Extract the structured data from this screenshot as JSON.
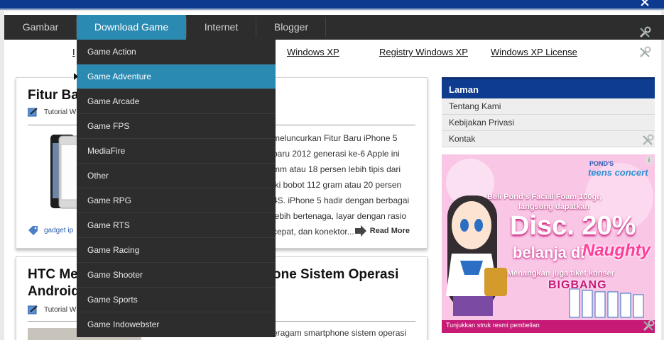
{
  "nav": {
    "items": [
      "Gambar",
      "Download Game",
      "Internet",
      "Blogger"
    ],
    "active": "Download Game"
  },
  "subnav": {
    "partial": "I",
    "links": [
      "Windows XP",
      "Registry Windows XP",
      "Windows XP License"
    ]
  },
  "dropdown": {
    "items": [
      "Game Action",
      "Game Adventure",
      "Game Arcade",
      "Game FPS",
      "MediaFire",
      "Other",
      "Game RPG",
      "Game RTS",
      "Game Racing",
      "Game Shooter",
      "Game Sports",
      "Game Indowebster"
    ],
    "hovered": "Game Adventure"
  },
  "post1": {
    "title_start": "Fitur Ba",
    "meta": "Tutorial W",
    "text_lines": [
      "meluncurkan Fitur Baru iPhone 5",
      "baru 2012 generasi ke-6 Apple ini",
      "mm atau 18 persen lebih tipis dari",
      "iki bobot 112 gram atau 20 persen",
      "4S. iPhone 5 hadir dengan berbagai",
      "lebih bertenaga, layar dengan rasio",
      "cepat, dan konektor..."
    ],
    "tag": "gadget ip",
    "read_more": "Read More"
  },
  "post2": {
    "title_line1_start": "HTC Me",
    "title_line1_end": "one Sistem Operasi",
    "title_line2": "Android",
    "meta": "Tutorial W",
    "text_line": "eragam smartphone sistem operasi"
  },
  "sidebar": {
    "heading": "Laman",
    "links": [
      "Tentang Kami",
      "Kebijakan Privasi",
      "Kontak"
    ]
  },
  "ad": {
    "brand_top": "POND'S",
    "brand_sub": "teens concert",
    "line1": "Beli Pond's Facial Foam 100gr,",
    "line2": "langsung dapatkan",
    "discount": "Disc. 20%",
    "line3a": "belanja di",
    "store": "Naughty",
    "line4": "Menangkan juga tiket konser",
    "band": "BIGBANG",
    "footer": "Tunjukkan struk resmi pembelian",
    "info": "i"
  },
  "colors": {
    "nav_bg": "#2d2d2d",
    "accent": "#2b8ab1",
    "topbar": "#0d3a8c",
    "widget_head": "#0e3c8f"
  }
}
